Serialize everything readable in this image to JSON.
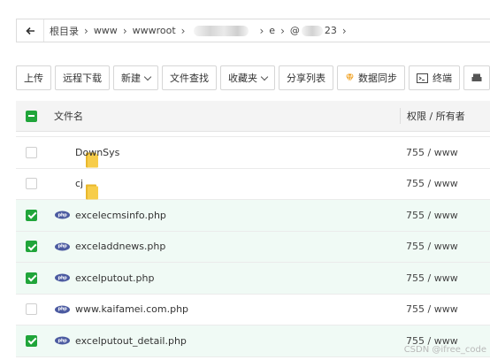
{
  "breadcrumb": {
    "items": [
      "根目录",
      "www",
      "wwwroot",
      "e",
      "@",
      "23"
    ]
  },
  "toolbar": {
    "upload": "上传",
    "remote_download": "远程下载",
    "new": "新建",
    "file_search": "文件查找",
    "favorites": "收藏夹",
    "share_list": "分享列表",
    "data_sync": "数据同步",
    "terminal": "终端"
  },
  "table": {
    "header": {
      "name": "文件名",
      "permission": "权限 / 所有者"
    },
    "rows": [
      {
        "name": "DownSys",
        "type": "folder",
        "perm": "755 / www",
        "checked": false
      },
      {
        "name": "cj",
        "type": "folder",
        "perm": "755 / www",
        "checked": false
      },
      {
        "name": "excelecmsinfo.php",
        "type": "php",
        "perm": "755 / www",
        "checked": true
      },
      {
        "name": "exceladdnews.php",
        "type": "php",
        "perm": "755 / www",
        "checked": true
      },
      {
        "name": "excelputout.php",
        "type": "php",
        "perm": "755 / www",
        "checked": true
      },
      {
        "name": "www.kaifamei.com.php",
        "type": "php",
        "perm": "755 / www",
        "checked": false
      },
      {
        "name": "excelputout_detail.php",
        "type": "php",
        "perm": "755 / www",
        "checked": true
      }
    ]
  },
  "icons": {
    "php_label": "php"
  },
  "colors": {
    "accent_green": "#20a53a",
    "selected_row": "#f0faf5",
    "folder": "#f7cd4a",
    "php": "#4b5aa0"
  },
  "watermark": "CSDN @ifree_code"
}
